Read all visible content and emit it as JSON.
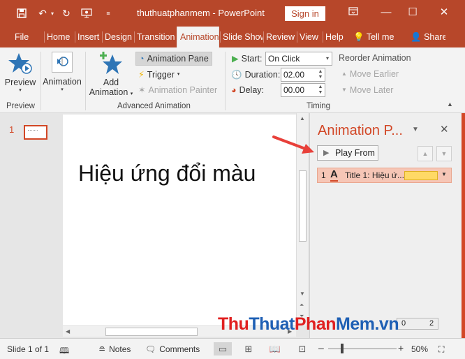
{
  "titlebar": {
    "title": "thuthuatphanmem - PowerPoint",
    "sign_in": "Sign in"
  },
  "tabs": [
    "File",
    "Home",
    "Insert",
    "Design",
    "Transition",
    "Animation",
    "Slide Show",
    "Review",
    "View",
    "Help",
    "Tell me",
    "Share"
  ],
  "ribbon": {
    "preview": "Preview",
    "animation": "Animation",
    "add_animation_1": "Add",
    "add_animation_2": "Animation",
    "animation_pane": "Animation Pane",
    "trigger": "Trigger",
    "animation_painter": "Animation Painter",
    "start_label": "Start:",
    "start_value": "On Click",
    "duration_label": "Duration:",
    "duration_value": "02.00",
    "delay_label": "Delay:",
    "delay_value": "00.00",
    "reorder": "Reorder Animation",
    "move_earlier": "Move Earlier",
    "move_later": "Move Later",
    "group_preview": "Preview",
    "group_advanced": "Advanced Animation",
    "group_timing": "Timing"
  },
  "thumbnails": {
    "slide_number": "1"
  },
  "slide": {
    "title": "Hiệu ứng đổi màu"
  },
  "animation_pane": {
    "title": "Animation P...",
    "play_from": "Play From",
    "item_number": "1",
    "item_label": "Title 1: Hiệu ứ..."
  },
  "page_box": {
    "left": "0",
    "right": "2"
  },
  "watermark": {
    "thu": "Thu",
    "thuat": "Thuat",
    "phan": "Phan",
    "mem": "Mem",
    "vn": ".vn"
  },
  "statusbar": {
    "slide_info": "Slide 1 of 1",
    "notes": "Notes",
    "comments": "Comments",
    "zoom": "50%"
  },
  "colors": {
    "accent": "#b7472a",
    "pane_title": "#d24726",
    "selected_item": "#f6c6b6",
    "duration_bar": "#ffd966",
    "watermark_red": "#e02020",
    "watermark_blue": "#1e5fb4"
  }
}
